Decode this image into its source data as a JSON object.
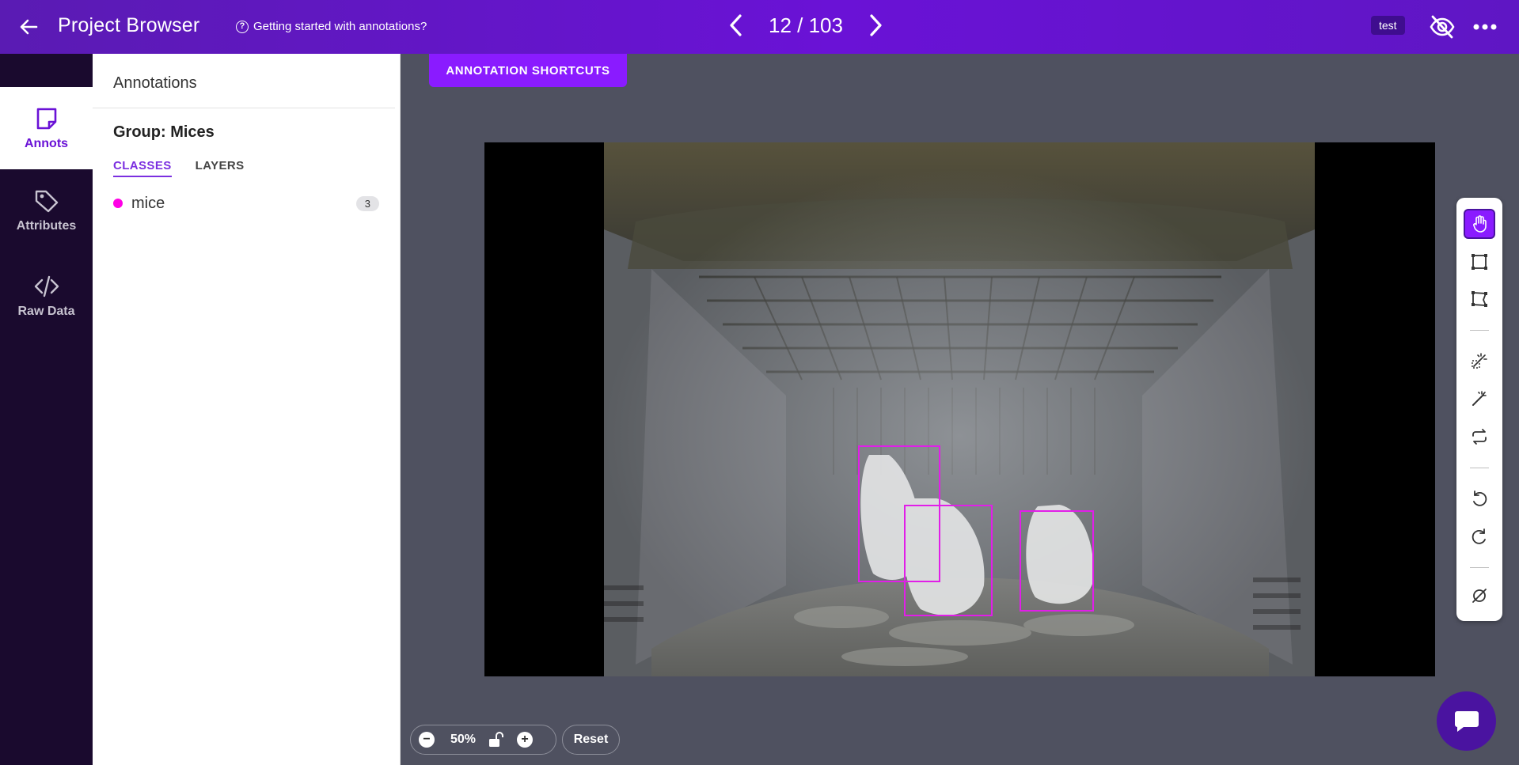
{
  "header": {
    "title": "Project Browser",
    "help_link": "Getting started with annotations?",
    "pager": "12 / 103",
    "user_badge": "test"
  },
  "rail": {
    "items": [
      {
        "label": "Annots",
        "icon": "sticky-note-icon",
        "active": true
      },
      {
        "label": "Attributes",
        "icon": "tags-icon",
        "active": false
      },
      {
        "label": "Raw Data",
        "icon": "code-icon",
        "active": false
      }
    ]
  },
  "panel": {
    "title": "Annotations",
    "group_title": "Group: Mices",
    "tabs": [
      "CLASSES",
      "LAYERS"
    ],
    "classes": [
      {
        "name": "mice",
        "count": "3",
        "color": "#ff00e6"
      }
    ]
  },
  "canvas": {
    "shortcuts_label": "ANNOTATION SHORTCUTS",
    "bbox_color": "#e11ee8"
  },
  "zoom": {
    "value": "50%",
    "reset_label": "Reset"
  },
  "toolbar": {
    "tools": [
      "hand-icon",
      "rectangle-icon",
      "polygon-icon",
      "magic-select-icon",
      "magic-wand-icon",
      "repeat-icon",
      "undo-icon",
      "redo-icon",
      "hide-icon"
    ]
  },
  "colors": {
    "accent": "#8a1bff",
    "topbar": "#6a12d6",
    "rail": "#1a0a2e",
    "canvas_bg": "#4f5160"
  }
}
